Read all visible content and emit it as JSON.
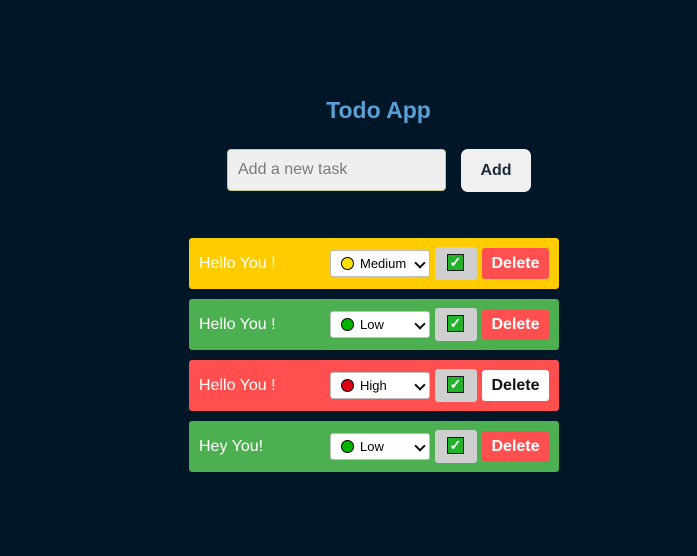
{
  "app": {
    "title": "Todo App"
  },
  "new_task": {
    "placeholder": "Add a new task",
    "value": "",
    "add_label": "Add"
  },
  "todos": [
    {
      "text": "Hello You !",
      "priority": "Medium",
      "priority_color": "#ffe000",
      "bg_color": "#ffcc00",
      "completed": true,
      "delete_label": "Delete"
    },
    {
      "text": "Hello You !",
      "priority": "Low",
      "priority_color": "#00b400",
      "bg_color": "#4caf50",
      "completed": true,
      "delete_label": "Delete"
    },
    {
      "text": "Hello You !",
      "priority": "High",
      "priority_color": "#e00014",
      "bg_color": "#ff4f4f",
      "completed": true,
      "delete_label": "Delete"
    },
    {
      "text": "Hey You!",
      "priority": "Low",
      "priority_color": "#00b400",
      "bg_color": "#4caf50",
      "completed": true,
      "delete_label": "Delete"
    }
  ],
  "icons": {
    "check": "check-icon",
    "priority_dot": "circle-icon",
    "dropdown": "chevron-down-icon"
  },
  "check_glyph": "✓"
}
